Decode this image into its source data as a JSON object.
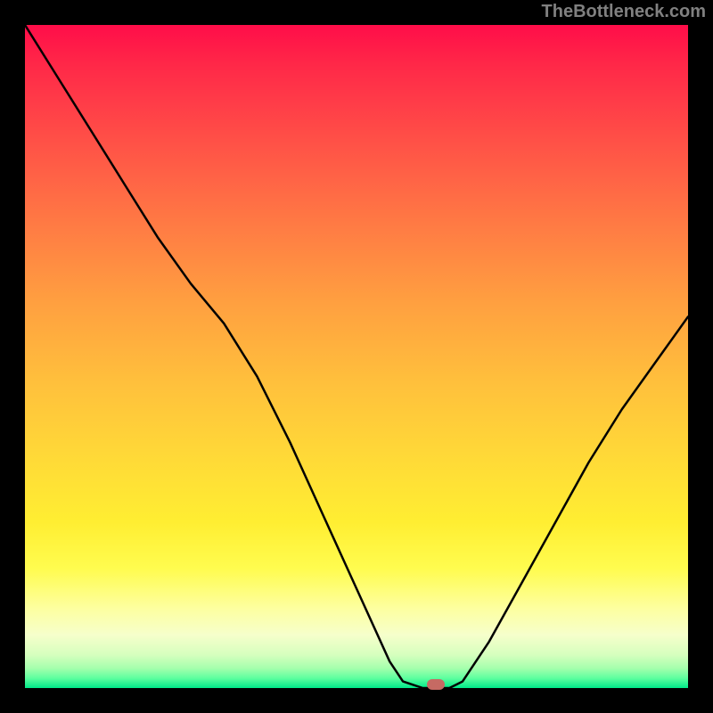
{
  "watermark": "TheBottleneck.com",
  "colors": {
    "frame": "#000000",
    "curve": "#000000",
    "marker": "#c66a63",
    "watermark": "#808080"
  },
  "chart_data": {
    "type": "line",
    "title": "",
    "xlabel": "",
    "ylabel": "",
    "xlim": [
      0,
      100
    ],
    "ylim": [
      0,
      100
    ],
    "grid": false,
    "legend_position": "none",
    "_comment": "y = bottleneck percentage (0 at base, 100 at top). x = position along horizontal axis (percent). Values estimated from rendered curve relative to plot area.",
    "series": [
      {
        "name": "bottleneck-curve",
        "x": [
          0,
          5,
          10,
          15,
          20,
          25,
          30,
          35,
          40,
          45,
          50,
          55,
          57,
          60,
          62,
          64,
          66,
          70,
          75,
          80,
          85,
          90,
          95,
          100
        ],
        "values": [
          100,
          92,
          84,
          76,
          68,
          61,
          55,
          47,
          37,
          26,
          15,
          4,
          1,
          0,
          0,
          0,
          1,
          7,
          16,
          25,
          34,
          42,
          49,
          56
        ]
      }
    ],
    "annotations": [
      {
        "name": "optimal-marker",
        "x": 62,
        "y": 0
      }
    ],
    "background_gradient": {
      "direction": "vertical",
      "stops": [
        {
          "pct": 0,
          "color": "#ff0d49"
        },
        {
          "pct": 18,
          "color": "#ff5247"
        },
        {
          "pct": 42,
          "color": "#ffa040"
        },
        {
          "pct": 66,
          "color": "#ffdb37"
        },
        {
          "pct": 82,
          "color": "#fffc4f"
        },
        {
          "pct": 95,
          "color": "#d6ffbe"
        },
        {
          "pct": 100,
          "color": "#00e989"
        }
      ]
    }
  }
}
